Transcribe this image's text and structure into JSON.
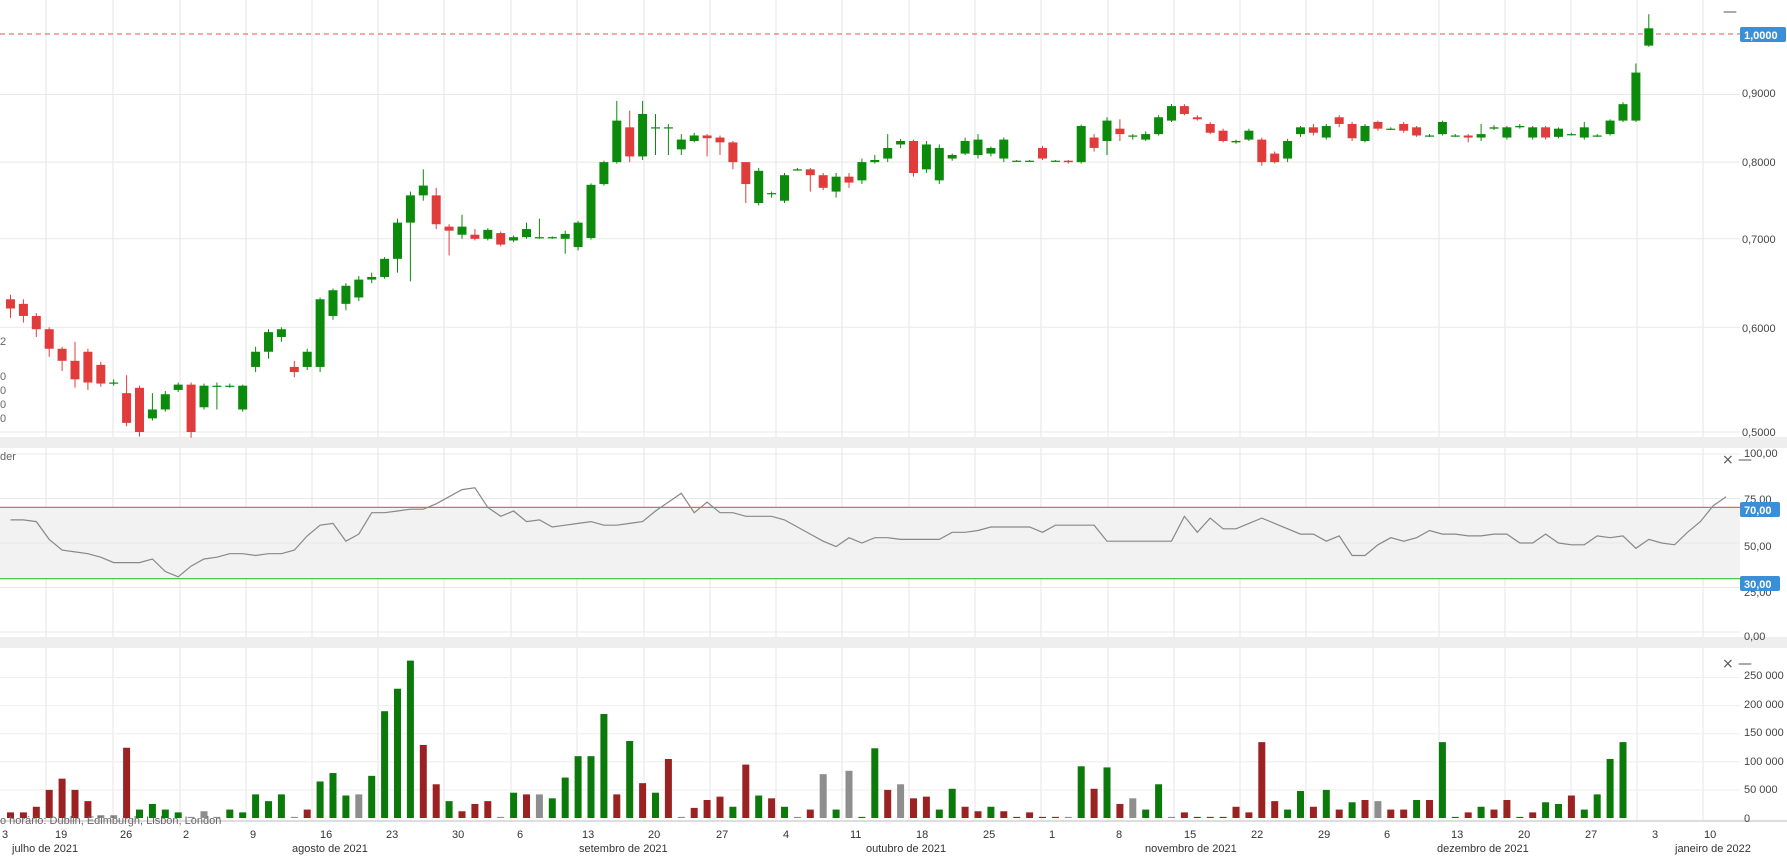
{
  "price_axis_labels": [
    "0,9000",
    "0,8000",
    "0,7000",
    "0,6000",
    "0,5000"
  ],
  "current_price_label": "1,0000",
  "rsi_axis_labels": [
    "100,00",
    "75,00",
    "50,00",
    "25,00",
    "0,00"
  ],
  "rsi_overbought_label": "70,00",
  "rsi_oversold_label": "30,00",
  "volume_axis_labels": [
    "250 000",
    "200 000",
    "150 000",
    "100 000",
    "50 000",
    "0"
  ],
  "left_fragments": {
    "price_a": "2",
    "price_b": "0",
    "price_c": "0",
    "price_d": "0",
    "price_e": "0",
    "rsi_name": "der",
    "timezone": "o horário: Dublin, Edimburgh, Lisbon, London"
  },
  "day_labels": [
    "3",
    "19",
    "26",
    "2",
    "9",
    "16",
    "23",
    "30",
    "6",
    "13",
    "20",
    "27",
    "4",
    "11",
    "18",
    "25",
    "1",
    "8",
    "15",
    "22",
    "29",
    "6",
    "13",
    "20",
    "27",
    "3",
    "10"
  ],
  "month_labels": [
    "julho de 2021",
    "agosto de 2021",
    "setembro de 2021",
    "outubro de 2021",
    "novembro de 2021",
    "dezembro de 2021",
    "janeiro de 2022"
  ],
  "colors": {
    "up": "#0b8a0b",
    "down": "#e03c3c",
    "volume_up": "#0b7a0b",
    "volume_down": "#9b2222",
    "volume_flat": "#8e8e8e",
    "badge": "#3a8fd6",
    "overbought": "#e06666",
    "oversold": "#4cc94c",
    "rsi_line": "#888888"
  },
  "chart_data": [
    {
      "type": "candlestick",
      "y_scale": "log",
      "ylim": [
        0.49,
        1.05
      ],
      "reference_line": 1.0,
      "candles": [
        [
          0.63,
          0.62,
          0.635,
          0.61
        ],
        [
          0.625,
          0.612,
          0.63,
          0.605
        ],
        [
          0.612,
          0.598,
          0.615,
          0.59
        ],
        [
          0.598,
          0.578,
          0.6,
          0.57
        ],
        [
          0.578,
          0.566,
          0.58,
          0.556
        ],
        [
          0.566,
          0.548,
          0.585,
          0.54
        ],
        [
          0.575,
          0.545,
          0.578,
          0.538
        ],
        [
          0.562,
          0.544,
          0.565,
          0.541
        ],
        [
          0.545,
          0.545,
          0.548,
          0.542
        ],
        [
          0.535,
          0.508,
          0.552,
          0.505
        ],
        [
          0.54,
          0.5,
          0.542,
          0.496
        ],
        [
          0.512,
          0.52,
          0.535,
          0.51
        ],
        [
          0.52,
          0.534,
          0.537,
          0.518
        ],
        [
          0.538,
          0.543,
          0.545,
          0.536
        ],
        [
          0.543,
          0.5,
          0.545,
          0.495
        ],
        [
          0.522,
          0.542,
          0.544,
          0.52
        ],
        [
          0.542,
          0.542,
          0.545,
          0.52
        ],
        [
          0.542,
          0.542,
          0.544,
          0.54
        ],
        [
          0.52,
          0.542,
          0.543,
          0.518
        ],
        [
          0.56,
          0.575,
          0.58,
          0.555
        ],
        [
          0.575,
          0.595,
          0.598,
          0.568
        ],
        [
          0.59,
          0.598,
          0.6,
          0.585
        ],
        [
          0.56,
          0.555,
          0.566,
          0.55
        ],
        [
          0.56,
          0.575,
          0.578,
          0.557
        ],
        [
          0.56,
          0.63,
          0.632,
          0.555
        ],
        [
          0.612,
          0.64,
          0.642,
          0.608
        ],
        [
          0.625,
          0.645,
          0.648,
          0.618
        ],
        [
          0.632,
          0.652,
          0.656,
          0.628
        ],
        [
          0.652,
          0.655,
          0.66,
          0.648
        ],
        [
          0.655,
          0.676,
          0.678,
          0.653
        ],
        [
          0.676,
          0.72,
          0.725,
          0.66
        ],
        [
          0.72,
          0.755,
          0.76,
          0.65
        ],
        [
          0.755,
          0.768,
          0.79,
          0.748
        ],
        [
          0.755,
          0.718,
          0.765,
          0.712
        ],
        [
          0.715,
          0.71,
          0.718,
          0.68
        ],
        [
          0.705,
          0.715,
          0.73,
          0.7
        ],
        [
          0.705,
          0.7,
          0.712,
          0.698
        ],
        [
          0.7,
          0.711,
          0.713,
          0.698
        ],
        [
          0.707,
          0.693,
          0.709,
          0.691
        ],
        [
          0.698,
          0.702,
          0.704,
          0.696
        ],
        [
          0.702,
          0.712,
          0.72,
          0.7
        ],
        [
          0.702,
          0.702,
          0.725,
          0.7
        ],
        [
          0.702,
          0.702,
          0.703,
          0.7
        ],
        [
          0.7,
          0.706,
          0.71,
          0.682
        ],
        [
          0.69,
          0.72,
          0.722,
          0.686
        ],
        [
          0.701,
          0.769,
          0.771,
          0.699
        ],
        [
          0.77,
          0.8,
          0.802,
          0.768
        ],
        [
          0.8,
          0.86,
          0.89,
          0.798
        ],
        [
          0.85,
          0.808,
          0.875,
          0.8
        ],
        [
          0.808,
          0.87,
          0.89,
          0.803
        ],
        [
          0.85,
          0.85,
          0.87,
          0.81
        ],
        [
          0.85,
          0.85,
          0.855,
          0.81
        ],
        [
          0.818,
          0.832,
          0.84,
          0.81
        ],
        [
          0.83,
          0.838,
          0.842,
          0.828
        ],
        [
          0.838,
          0.834,
          0.84,
          0.808
        ],
        [
          0.835,
          0.828,
          0.838,
          0.81
        ],
        [
          0.828,
          0.8,
          0.83,
          0.79
        ],
        [
          0.8,
          0.77,
          0.8,
          0.745
        ],
        [
          0.745,
          0.788,
          0.792,
          0.742
        ],
        [
          0.758,
          0.758,
          0.76,
          0.752
        ],
        [
          0.748,
          0.782,
          0.785,
          0.745
        ],
        [
          0.79,
          0.79,
          0.792,
          0.788
        ],
        [
          0.79,
          0.782,
          0.792,
          0.76
        ],
        [
          0.782,
          0.765,
          0.785,
          0.762
        ],
        [
          0.76,
          0.78,
          0.785,
          0.752
        ],
        [
          0.78,
          0.772,
          0.785,
          0.765
        ],
        [
          0.775,
          0.8,
          0.805,
          0.77
        ],
        [
          0.8,
          0.803,
          0.81,
          0.798
        ],
        [
          0.805,
          0.82,
          0.84,
          0.8
        ],
        [
          0.825,
          0.83,
          0.833,
          0.82
        ],
        [
          0.83,
          0.785,
          0.832,
          0.78
        ],
        [
          0.79,
          0.825,
          0.83,
          0.785
        ],
        [
          0.775,
          0.82,
          0.825,
          0.77
        ],
        [
          0.805,
          0.81,
          0.812,
          0.802
        ],
        [
          0.812,
          0.83,
          0.835,
          0.81
        ],
        [
          0.81,
          0.832,
          0.84,
          0.805
        ],
        [
          0.812,
          0.82,
          0.822,
          0.808
        ],
        [
          0.805,
          0.832,
          0.835,
          0.8
        ],
        [
          0.802,
          0.802,
          0.803,
          0.801
        ],
        [
          0.802,
          0.802,
          0.803,
          0.801
        ],
        [
          0.82,
          0.805,
          0.823,
          0.803
        ],
        [
          0.802,
          0.802,
          0.803,
          0.801
        ],
        [
          0.802,
          0.8,
          0.803,
          0.798
        ],
        [
          0.8,
          0.852,
          0.854,
          0.798
        ],
        [
          0.835,
          0.82,
          0.84,
          0.815
        ],
        [
          0.83,
          0.86,
          0.865,
          0.81
        ],
        [
          0.848,
          0.84,
          0.862,
          0.83
        ],
        [
          0.838,
          0.838,
          0.84,
          0.832
        ],
        [
          0.832,
          0.84,
          0.844,
          0.83
        ],
        [
          0.84,
          0.865,
          0.868,
          0.838
        ],
        [
          0.86,
          0.882,
          0.885,
          0.858
        ],
        [
          0.882,
          0.87,
          0.885,
          0.868
        ],
        [
          0.865,
          0.862,
          0.868,
          0.86
        ],
        [
          0.855,
          0.842,
          0.858,
          0.84
        ],
        [
          0.845,
          0.83,
          0.848,
          0.828
        ],
        [
          0.828,
          0.83,
          0.832,
          0.826
        ],
        [
          0.832,
          0.845,
          0.848,
          0.83
        ],
        [
          0.832,
          0.8,
          0.835,
          0.795
        ],
        [
          0.812,
          0.8,
          0.815,
          0.798
        ],
        [
          0.805,
          0.83,
          0.833,
          0.8
        ],
        [
          0.84,
          0.85,
          0.852,
          0.836
        ],
        [
          0.85,
          0.842,
          0.855,
          0.838
        ],
        [
          0.835,
          0.852,
          0.855,
          0.832
        ],
        [
          0.865,
          0.855,
          0.868,
          0.85
        ],
        [
          0.855,
          0.834,
          0.858,
          0.83
        ],
        [
          0.83,
          0.852,
          0.855,
          0.828
        ],
        [
          0.858,
          0.848,
          0.86,
          0.845
        ],
        [
          0.848,
          0.848,
          0.85,
          0.846
        ],
        [
          0.855,
          0.845,
          0.858,
          0.842
        ],
        [
          0.85,
          0.838,
          0.852,
          0.836
        ],
        [
          0.838,
          0.838,
          0.84,
          0.836
        ],
        [
          0.84,
          0.858,
          0.86,
          0.838
        ],
        [
          0.838,
          0.838,
          0.84,
          0.836
        ],
        [
          0.838,
          0.835,
          0.84,
          0.828
        ],
        [
          0.835,
          0.84,
          0.855,
          0.83
        ],
        [
          0.848,
          0.85,
          0.853,
          0.846
        ],
        [
          0.835,
          0.85,
          0.852,
          0.832
        ],
        [
          0.85,
          0.852,
          0.855,
          0.848
        ],
        [
          0.835,
          0.85,
          0.852,
          0.832
        ],
        [
          0.85,
          0.835,
          0.852,
          0.832
        ],
        [
          0.836,
          0.848,
          0.85,
          0.834
        ],
        [
          0.84,
          0.84,
          0.842,
          0.838
        ],
        [
          0.835,
          0.85,
          0.858,
          0.832
        ],
        [
          0.838,
          0.838,
          0.84,
          0.836
        ],
        [
          0.84,
          0.86,
          0.862,
          0.838
        ],
        [
          0.86,
          0.885,
          0.888,
          0.858
        ],
        [
          0.86,
          0.935,
          0.95,
          0.858
        ],
        [
          0.98,
          1.01,
          1.035,
          0.978
        ]
      ]
    },
    {
      "type": "line",
      "ylim": [
        0,
        100
      ],
      "reference_lines": [
        70,
        30
      ],
      "values": [
        63,
        63,
        62,
        52,
        46,
        45,
        44,
        42,
        39,
        39,
        39,
        41,
        34,
        31,
        37,
        41,
        42,
        44,
        44,
        43,
        44,
        44,
        46,
        54,
        60,
        61,
        51,
        55,
        67,
        67,
        68,
        69,
        69,
        72,
        76,
        80,
        81,
        70,
        65,
        68,
        62,
        63,
        59,
        60,
        61,
        62,
        60,
        60,
        61,
        62,
        68,
        73,
        78,
        67,
        73,
        67,
        67,
        65,
        65,
        65,
        63,
        59,
        55,
        51,
        48,
        53,
        50,
        53,
        53,
        52,
        52,
        52,
        52,
        56,
        56,
        57,
        59,
        59,
        59,
        59,
        56,
        60,
        60,
        60,
        60,
        51,
        51,
        51,
        51,
        51,
        51,
        65,
        56,
        64,
        58,
        58,
        61,
        64,
        61,
        58,
        55,
        55,
        51,
        54,
        43,
        43,
        49,
        53,
        51,
        53,
        57,
        55,
        55,
        54,
        54,
        55,
        55,
        50,
        50,
        55,
        50,
        49,
        49,
        54,
        53,
        54,
        47,
        52,
        50,
        49,
        56,
        62,
        71,
        76
      ]
    },
    {
      "type": "bar",
      "ylim": [
        0,
        290000
      ],
      "values": [
        10000,
        10000,
        20000,
        50000,
        70000,
        50000,
        30000,
        5000,
        5000,
        125000,
        15000,
        25000,
        15000,
        10000,
        2000,
        12000,
        2000,
        15000,
        10000,
        42000,
        30000,
        42000,
        2000,
        15000,
        65000,
        80000,
        40000,
        42000,
        75000,
        190000,
        230000,
        280000,
        130000,
        60000,
        30000,
        12000,
        25000,
        30000,
        2000,
        45000,
        42000,
        42000,
        35000,
        72000,
        110000,
        110000,
        185000,
        42000,
        137000,
        62000,
        45000,
        105000,
        2000,
        18000,
        32000,
        38000,
        20000,
        95000,
        40000,
        35000,
        20000,
        2000,
        15000,
        78000,
        15000,
        84000,
        2000,
        124000,
        50000,
        60000,
        35000,
        38000,
        15000,
        52000,
        20000,
        12000,
        20000,
        12000,
        2000,
        10000,
        2000,
        2000,
        2000,
        92000,
        52000,
        90000,
        25000,
        35000,
        15000,
        60000,
        2000,
        10000,
        2000,
        2000,
        2000,
        20000,
        10000,
        135000,
        30000,
        15000,
        48000,
        20000,
        50000,
        15000,
        28000,
        32000,
        30000,
        15000,
        15000,
        32000,
        32000,
        135000,
        2000,
        10000,
        20000,
        15000,
        32000,
        2000,
        10000,
        28000,
        25000,
        40000,
        15000,
        42000,
        105000,
        135000
      ],
      "states": [
        "d",
        "d",
        "d",
        "d",
        "d",
        "d",
        "d",
        "f",
        "f",
        "d",
        "u",
        "u",
        "u",
        "u",
        "f",
        "f",
        "f",
        "u",
        "u",
        "u",
        "u",
        "u",
        "f",
        "d",
        "u",
        "u",
        "u",
        "f",
        "u",
        "u",
        "u",
        "u",
        "d",
        "d",
        "u",
        "d",
        "d",
        "d",
        "f",
        "u",
        "d",
        "f",
        "u",
        "u",
        "u",
        "u",
        "u",
        "d",
        "u",
        "d",
        "u",
        "d",
        "f",
        "d",
        "d",
        "d",
        "u",
        "d",
        "u",
        "d",
        "u",
        "f",
        "d",
        "f",
        "u",
        "f",
        "u",
        "u",
        "d",
        "f",
        "d",
        "d",
        "u",
        "u",
        "d",
        "d",
        "u",
        "d",
        "d",
        "d",
        "d",
        "d",
        "f",
        "u",
        "d",
        "u",
        "d",
        "f",
        "u",
        "u",
        "f",
        "d",
        "d",
        "d",
        "d",
        "d",
        "d",
        "d",
        "d",
        "u",
        "u",
        "d",
        "u",
        "d",
        "u",
        "d",
        "f",
        "d",
        "d",
        "u",
        "d",
        "u",
        "u",
        "d",
        "u",
        "d",
        "d",
        "u",
        "d",
        "u",
        "u",
        "d",
        "u",
        "u",
        "u",
        "u"
      ]
    }
  ]
}
